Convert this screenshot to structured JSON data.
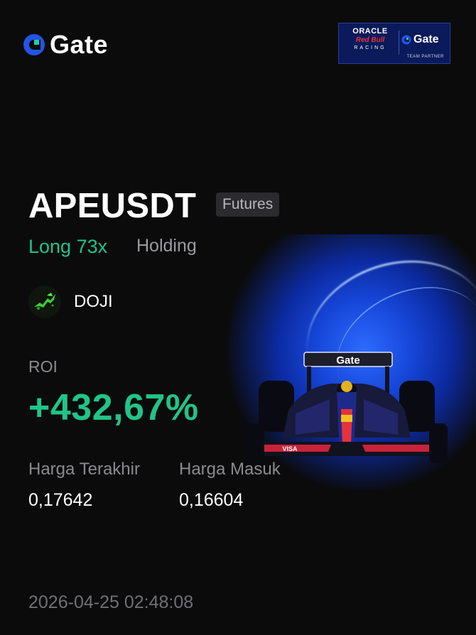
{
  "brand": {
    "name": "Gate",
    "accent": "#2354e6",
    "logo_icon": "gate-logo-icon"
  },
  "partner": {
    "line1": "ORACLE",
    "line2": "Red Bull",
    "line3": "RACING",
    "brand": "Gate",
    "tagline": "TEAM PARTNER"
  },
  "position": {
    "pair": "APEUSDT",
    "market_type": "Futures",
    "direction": "Long 73x",
    "status": "Holding",
    "direction_color": "#20c489"
  },
  "user": {
    "name": "DOJI",
    "avatar_icon": "bull-avatar-icon"
  },
  "roi": {
    "label": "ROI",
    "value": "+432,67%",
    "color": "#20c489"
  },
  "prices": {
    "last_label": "Harga Terakhir",
    "last_value": "0,17642",
    "entry_label": "Harga Masuk",
    "entry_value": "0,16604"
  },
  "timestamp": "2026-04-25 02:48:08",
  "decor": {
    "car_image": "f1-race-car-image",
    "car_livery_text": "Gate"
  }
}
